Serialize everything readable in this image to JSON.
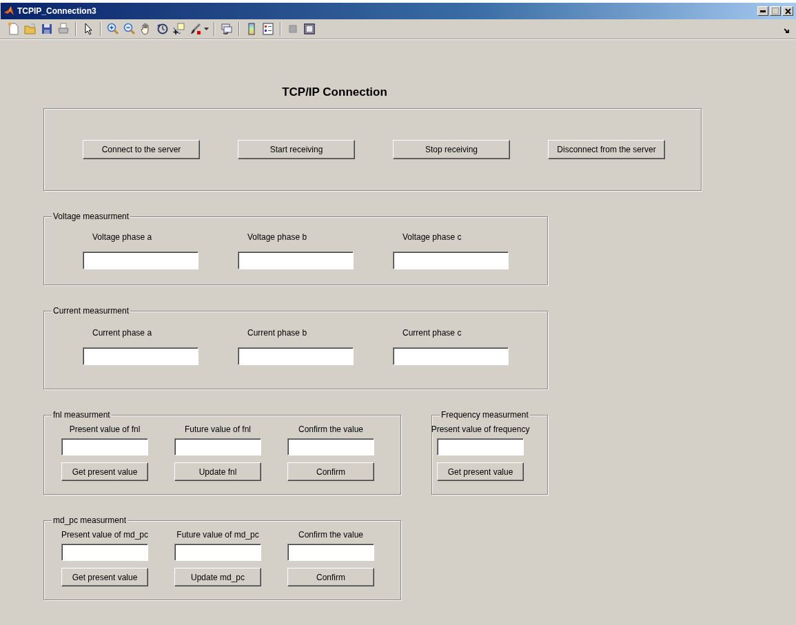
{
  "window": {
    "title": "TCPIP_Connection3"
  },
  "heading": "TCP/IP Connection",
  "connection_buttons": [
    {
      "label": "Connect to the server"
    },
    {
      "label": "Start receiving"
    },
    {
      "label": "Stop receiving"
    },
    {
      "label": "Disconnect from the server"
    }
  ],
  "panel_rows": [
    [
      {
        "title": "Voltage measurment",
        "kind": "wide",
        "columns": [
          {
            "label": "Voltage phase a"
          },
          {
            "label": "Voltage phase b"
          },
          {
            "label": "Voltage phase c"
          }
        ]
      }
    ],
    [
      {
        "title": "Current measurment",
        "kind": "wide",
        "columns": [
          {
            "label": "Current phase a"
          },
          {
            "label": "Current phase b"
          },
          {
            "label": "Current phase c"
          }
        ]
      }
    ],
    [
      {
        "title": "fnl measurment",
        "kind": "compact",
        "columns": [
          {
            "label": "Present value of fnl",
            "button": "Get present value"
          },
          {
            "label": "Future value of fnl",
            "button": "Update fnl"
          },
          {
            "label": "Confirm the value",
            "button": "Confirm"
          }
        ]
      },
      {
        "title": "Frequency measurment",
        "kind": "compact",
        "columns": [
          {
            "label": "Present value of frequency",
            "button": "Get present value"
          }
        ]
      }
    ],
    [
      {
        "title": "md_pc measurment",
        "kind": "compact",
        "columns": [
          {
            "label": "Present value of md_pc",
            "button": "Get present value"
          },
          {
            "label": "Future value of md_pc",
            "button": "Update md_pc"
          },
          {
            "label": "Confirm the value",
            "button": "Confirm"
          }
        ]
      }
    ]
  ]
}
